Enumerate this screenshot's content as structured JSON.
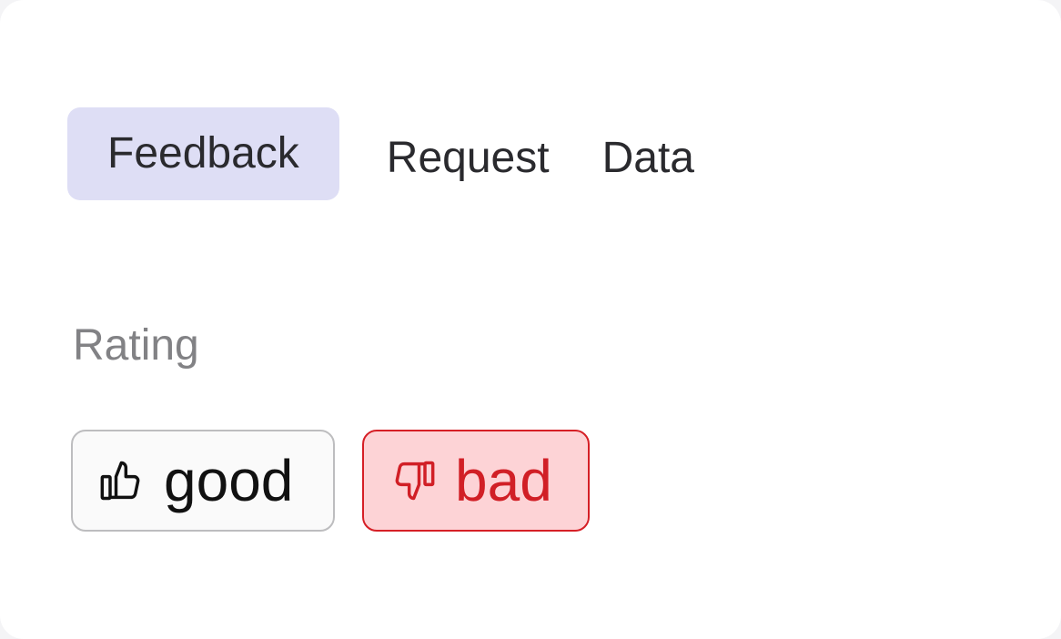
{
  "tabs": [
    {
      "label": "Feedback",
      "active": true
    },
    {
      "label": "Request",
      "active": false
    },
    {
      "label": "Data",
      "active": false
    }
  ],
  "rating": {
    "label": "Rating",
    "options": [
      {
        "label": "good",
        "icon": "thumbs-up-icon",
        "selected": false
      },
      {
        "label": "bad",
        "icon": "thumbs-down-icon",
        "selected": true
      }
    ]
  },
  "colors": {
    "active_tab_bg": "#dedef5",
    "bad_border": "#d61f26",
    "bad_bg": "#fdd3d6",
    "bad_text": "#d11f26"
  }
}
